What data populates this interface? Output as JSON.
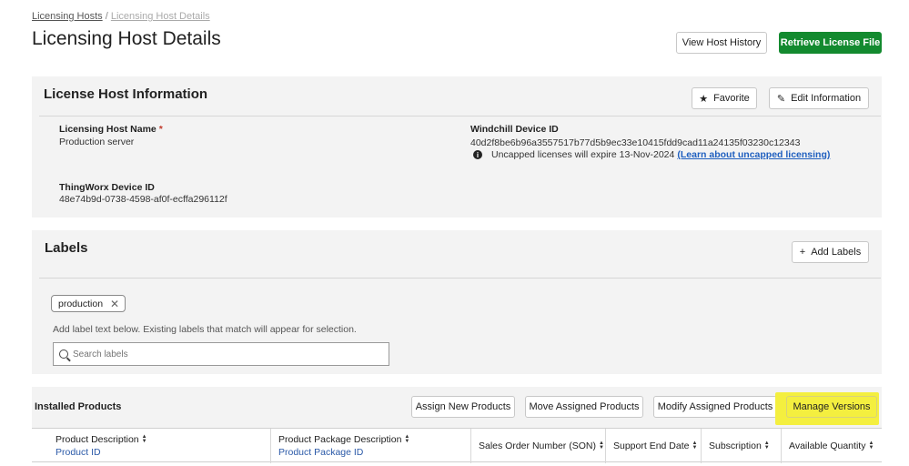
{
  "breadcrumb": {
    "parent": "Licensing Hosts",
    "separator": "/",
    "current": "Licensing Host Details"
  },
  "page_title": "Licensing Host Details",
  "header_actions": {
    "view_history": "View Host History",
    "retrieve_license": "Retrieve License File"
  },
  "host_info": {
    "title": "License Host Information",
    "favorite_label": "Favorite",
    "edit_label": "Edit Information",
    "host_name_label": "Licensing Host Name",
    "required_mark": "*",
    "host_name_value": "Production server",
    "windchill_label": "Windchill Device ID",
    "windchill_value": "40d2f8be6b96a3557517b77d5b9ec33e10415fdd9cad11a24135f03230c12343",
    "uncapped_text": "Uncapped licenses will expire 13-Nov-2024",
    "uncapped_link": "(Learn about uncapped licensing)",
    "thingworx_label": "ThingWorx Device ID",
    "thingworx_value": "48e74b9d-0738-4598-af0f-ecffa296112f"
  },
  "labels": {
    "title": "Labels",
    "add_label": "Add Labels",
    "tags": [
      "production"
    ],
    "hint": "Add label text below. Existing labels that match will appear for selection.",
    "search_placeholder": "Search labels"
  },
  "installed": {
    "title": "Installed Products",
    "assign_new": "Assign New Products",
    "move_assigned": "Move Assigned Products",
    "modify_assigned": "Modify Assigned Products",
    "manage_versions": "Manage Versions",
    "highlight_color": "#f4ef3f",
    "columns": [
      {
        "title": "Product Description",
        "sub": "Product ID"
      },
      {
        "title": "Product Package Description",
        "sub": "Product Package ID"
      },
      {
        "title": "Sales Order Number (SON)",
        "sub": ""
      },
      {
        "title": "Support End Date",
        "sub": ""
      },
      {
        "title": "Subscription",
        "sub": ""
      },
      {
        "title": "Available Quantity",
        "sub": ""
      }
    ]
  },
  "colors": {
    "primary": "#138a2f",
    "link": "#1f5fbf",
    "required": "#c0392b",
    "panel_bg": "#f3f3f3"
  },
  "icons": {
    "favorite": "star-icon",
    "edit": "pencil-icon",
    "add": "plus-icon",
    "info": "info-icon",
    "remove_tag": "close-icon",
    "search": "search-icon",
    "sort": "sort-icon"
  }
}
